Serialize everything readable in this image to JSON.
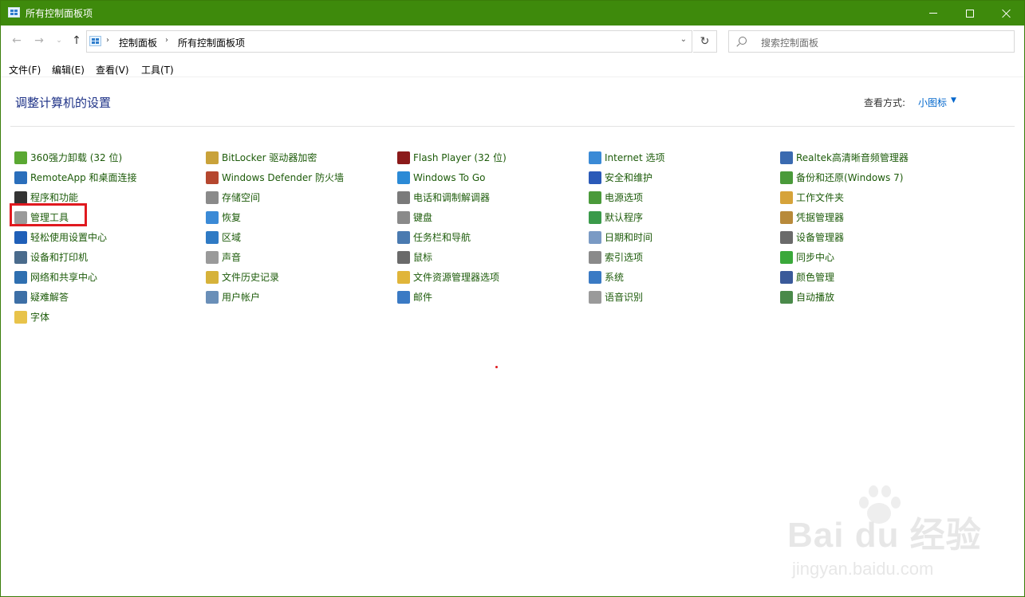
{
  "window": {
    "title": "所有控制面板项"
  },
  "nav": {
    "back": "←",
    "forward": "→",
    "recent": "⌄",
    "up": "↑",
    "refresh": "↻",
    "dropdown": "⌄",
    "breadcrumbs": [
      "控制面板",
      "所有控制面板项"
    ],
    "breadcrumb_sep": "›",
    "search_placeholder": "搜索控制面板"
  },
  "menu": [
    "文件(F)",
    "编辑(E)",
    "查看(V)",
    "工具(T)"
  ],
  "heading": "调整计算机的设置",
  "view_by": {
    "label": "查看方式:",
    "value": "小图标",
    "arrow": "▼"
  },
  "columns": [
    [
      {
        "label": "360强力卸载 (32 位)",
        "icon": "uninstall-icon",
        "color": "#5aa832"
      },
      {
        "label": "RemoteApp 和桌面连接",
        "icon": "remote-desktop-icon",
        "color": "#2a6ebb"
      },
      {
        "label": "程序和功能",
        "icon": "programs-icon",
        "color": "#333333"
      },
      {
        "label": "管理工具",
        "icon": "admin-tools-icon",
        "color": "#9a9a9a"
      },
      {
        "label": "轻松使用设置中心",
        "icon": "ease-of-access-icon",
        "color": "#1f5fb8"
      },
      {
        "label": "设备和打印机",
        "icon": "printer-icon",
        "color": "#4a6b8c"
      },
      {
        "label": "网络和共享中心",
        "icon": "network-icon",
        "color": "#2f6fb0"
      },
      {
        "label": "疑难解答",
        "icon": "troubleshoot-icon",
        "color": "#3d6fa6"
      },
      {
        "label": "字体",
        "icon": "font-icon",
        "color": "#e8c34a"
      }
    ],
    [
      {
        "label": "BitLocker 驱动器加密",
        "icon": "bitlocker-icon",
        "color": "#c9a23a"
      },
      {
        "label": "Windows Defender 防火墙",
        "icon": "firewall-icon",
        "color": "#b5472f"
      },
      {
        "label": "存储空间",
        "icon": "storage-icon",
        "color": "#8a8a8a"
      },
      {
        "label": "恢复",
        "icon": "recovery-icon",
        "color": "#3b8ad6"
      },
      {
        "label": "区域",
        "icon": "region-icon",
        "color": "#2f7ac4"
      },
      {
        "label": "声音",
        "icon": "sound-icon",
        "color": "#9a9a9a"
      },
      {
        "label": "文件历史记录",
        "icon": "file-history-icon",
        "color": "#d6b23a"
      },
      {
        "label": "用户帐户",
        "icon": "user-accounts-icon",
        "color": "#6a8fb8"
      }
    ],
    [
      {
        "label": "Flash Player (32 位)",
        "icon": "flash-icon",
        "color": "#8b1a1a"
      },
      {
        "label": "Windows To Go",
        "icon": "windows-to-go-icon",
        "color": "#2b8ad6"
      },
      {
        "label": "电话和调制解调器",
        "icon": "phone-modem-icon",
        "color": "#7a7a7a"
      },
      {
        "label": "键盘",
        "icon": "keyboard-icon",
        "color": "#8a8a8a"
      },
      {
        "label": "任务栏和导航",
        "icon": "taskbar-icon",
        "color": "#4a7ab0"
      },
      {
        "label": "鼠标",
        "icon": "mouse-icon",
        "color": "#6a6a6a"
      },
      {
        "label": "文件资源管理器选项",
        "icon": "folder-options-icon",
        "color": "#e0b53a"
      },
      {
        "label": "邮件",
        "icon": "mail-icon",
        "color": "#3a7ac4"
      }
    ],
    [
      {
        "label": "Internet 选项",
        "icon": "internet-options-icon",
        "color": "#3a8ad6"
      },
      {
        "label": "安全和维护",
        "icon": "security-flag-icon",
        "color": "#2a5ab8"
      },
      {
        "label": "电源选项",
        "icon": "power-icon",
        "color": "#4a9a3a"
      },
      {
        "label": "默认程序",
        "icon": "default-programs-icon",
        "color": "#3a9a4a"
      },
      {
        "label": "日期和时间",
        "icon": "date-time-icon",
        "color": "#7a9ac4"
      },
      {
        "label": "索引选项",
        "icon": "indexing-icon",
        "color": "#8a8a8a"
      },
      {
        "label": "系统",
        "icon": "system-icon",
        "color": "#3a7ac4"
      },
      {
        "label": "语音识别",
        "icon": "speech-icon",
        "color": "#9a9a9a"
      }
    ],
    [
      {
        "label": "Realtek高清晰音频管理器",
        "icon": "realtek-audio-icon",
        "color": "#3a6ab0"
      },
      {
        "label": "备份和还原(Windows 7)",
        "icon": "backup-icon",
        "color": "#4a9a3a"
      },
      {
        "label": "工作文件夹",
        "icon": "work-folders-icon",
        "color": "#d6a33a"
      },
      {
        "label": "凭据管理器",
        "icon": "credential-icon",
        "color": "#b88a3a"
      },
      {
        "label": "设备管理器",
        "icon": "device-manager-icon",
        "color": "#6a6a6a"
      },
      {
        "label": "同步中心",
        "icon": "sync-icon",
        "color": "#3aa83a"
      },
      {
        "label": "颜色管理",
        "icon": "color-management-icon",
        "color": "#3a5a9a"
      },
      {
        "label": "自动播放",
        "icon": "autoplay-icon",
        "color": "#4a8a4a"
      }
    ]
  ],
  "watermark": {
    "brand": "Bai du 经验",
    "url": "jingyan.baidu.com"
  }
}
